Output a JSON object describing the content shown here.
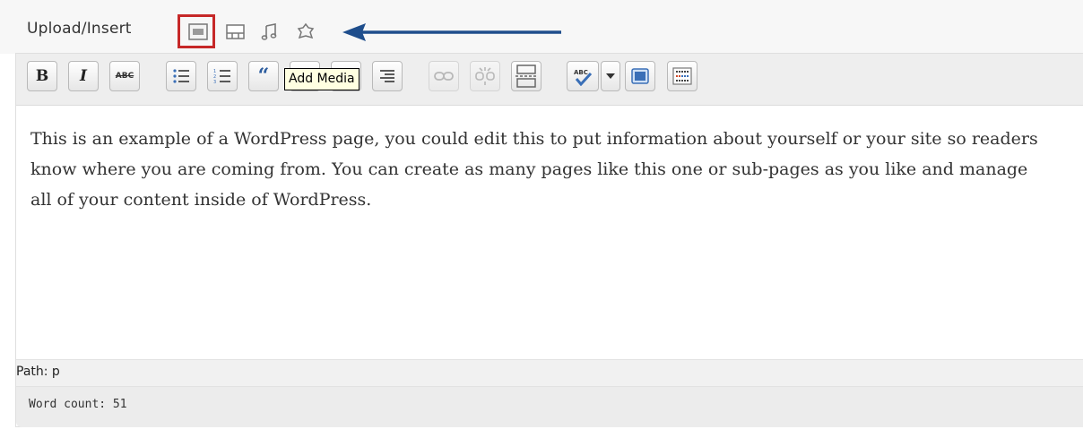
{
  "upload": {
    "label": "Upload/Insert",
    "icons": [
      "add-media-icon",
      "image-icon",
      "audio-icon",
      "video-icon"
    ]
  },
  "toolbar": {
    "buttons": [
      "bold",
      "italic",
      "strikethrough",
      "bullet-list",
      "numbered-list",
      "blockquote",
      "align-left",
      "align-center",
      "align-right",
      "insert-link",
      "remove-link",
      "insert-more",
      "spellcheck",
      "spellcheck-dropdown",
      "fullscreen",
      "kitchen-sink"
    ],
    "bold_label": "B",
    "italic_label": "I",
    "strike_label": "ABC",
    "quote_label": "“",
    "spell_label": "ABC"
  },
  "tooltip": {
    "text": "Add Media"
  },
  "content": {
    "text": "This is an example of a WordPress page, you could edit this to put information about yourself or your site so readers know where you are coming from. You can create as many pages like this one or sub-pages as you like and manage all of your content inside of WordPress."
  },
  "status": {
    "path": "Path: p",
    "word_count": "Word count: 51"
  },
  "colors": {
    "highlight": "#c62828",
    "arrow": "#1f4e8c",
    "tooltip_bg": "#ffffe1"
  }
}
